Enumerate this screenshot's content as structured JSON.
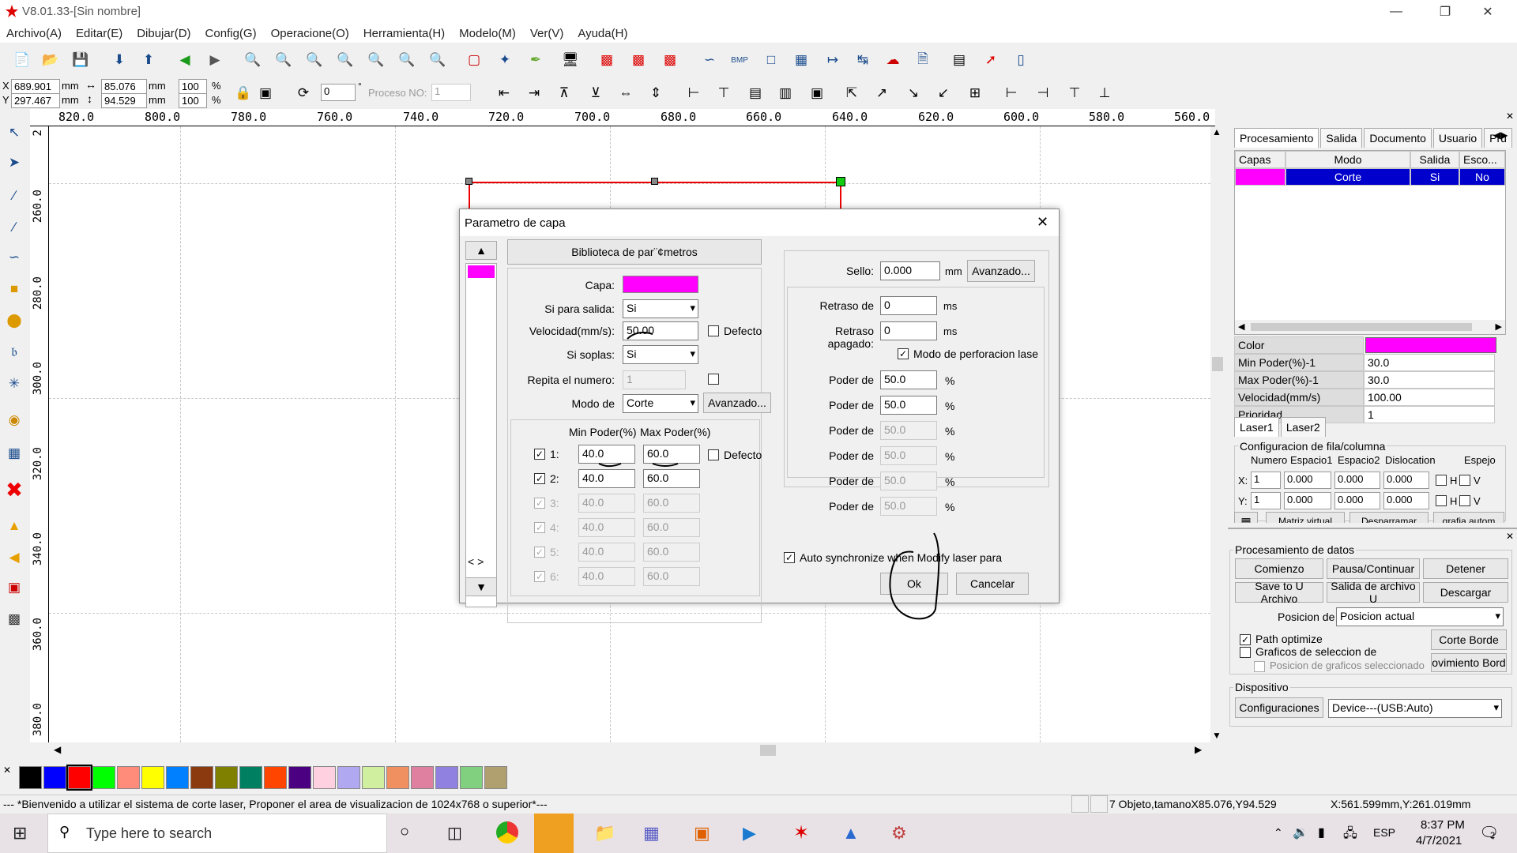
{
  "app": {
    "title": "V8.01.33-[Sin nombre]",
    "window_controls": [
      "minimize-icon",
      "restore-icon",
      "close-icon"
    ]
  },
  "menu": [
    "Archivo(A)",
    "Editar(E)",
    "Dibujar(D)",
    "Config(G)",
    "Operacione(O)",
    "Herramienta(H)",
    "Modelo(M)",
    "Ver(V)",
    "Ayuda(H)"
  ],
  "position": {
    "x": "689.901",
    "y": "297.467",
    "unit": "mm",
    "width": "85.076",
    "height": "94.529",
    "scale_w": "100",
    "scale_h": "100",
    "pct": "%",
    "rotation": "0",
    "rotation_unit": "°",
    "proceso_label": "Proceso NO:",
    "proceso_value": "1"
  },
  "ruler_h": [
    "820.0",
    "800.0",
    "780.0",
    "760.0",
    "740.0",
    "720.0",
    "700.0",
    "680.0",
    "660.0",
    "640.0",
    "620.0",
    "600.0",
    "580.0",
    "560.0"
  ],
  "ruler_v": [
    "2",
    "260.0",
    "280.0",
    "300.0",
    "320.0",
    "340.0",
    "360.0",
    "380.0"
  ],
  "palette": [
    "#000000",
    "#0000ff",
    "#ff0000",
    "#00ff00",
    "#ff8c7a",
    "#ffff00",
    "#0080ff",
    "#8b3a0f",
    "#808000",
    "#008060",
    "#ff4500",
    "#4b0082",
    "#ffd0e0",
    "#b0a8f0",
    "#d0f0a0",
    "#f09060",
    "#e080a0",
    "#9080e0",
    "#80d080",
    "#b0a070"
  ],
  "status": {
    "message": "--- *Bienvenido a utilizar el sistema de corte laser, Proponer el area de visualizacion de 1024x768 o superior*---",
    "objects": "7 Objeto,tamanoX85.076,Y94.529",
    "coords": "X:561.599mm,Y:261.019mm"
  },
  "dialog": {
    "title": "Parametro de capa",
    "library_button": "Biblioteca de par¨¢metros",
    "capa_label": "Capa:",
    "capa_color": "#ff00ff",
    "salida_label": "Si para salida:",
    "salida_value": "Si",
    "velocidad_label": "Velocidad(mm/s):",
    "velocidad_value": "50.00",
    "defecto_label": "Defecto",
    "soplas_label": "Si soplas:",
    "soplas_value": "Si",
    "repita_label": "Repita el numero:",
    "repita_value": "1",
    "modo_label": "Modo de",
    "modo_value": "Corte",
    "avanzado_label": "Avanzado...",
    "min_header": "Min Poder(%)",
    "max_header": "Max Poder(%)",
    "power_defecto": "Defecto",
    "power_rows": [
      {
        "n": "1:",
        "min": "40.0",
        "max": "60.0",
        "enabled": true
      },
      {
        "n": "2:",
        "min": "40.0",
        "max": "60.0",
        "enabled": true
      },
      {
        "n": "3:",
        "min": "40.0",
        "max": "60.0",
        "enabled": false
      },
      {
        "n": "4:",
        "min": "40.0",
        "max": "60.0",
        "enabled": false
      },
      {
        "n": "5:",
        "min": "40.0",
        "max": "60.0",
        "enabled": false
      },
      {
        "n": "6:",
        "min": "40.0",
        "max": "60.0",
        "enabled": false
      }
    ],
    "sello_label": "Sello:",
    "sello_value": "0.000",
    "sello_unit": "mm",
    "sello_avanzado": "Avanzado...",
    "retraso_label": "Retraso de",
    "retraso_value": "0",
    "retraso_apagado_label": "Retraso apagado:",
    "retraso_apagado_value": "0",
    "ms": "ms",
    "perforacion_label": "Modo de perforacion lase",
    "poder_label": "Poder de",
    "poder_rows": [
      {
        "value": "50.0",
        "enabled": true
      },
      {
        "value": "50.0",
        "enabled": true
      },
      {
        "value": "50.0",
        "enabled": false
      },
      {
        "value": "50.0",
        "enabled": false
      },
      {
        "value": "50.0",
        "enabled": false
      },
      {
        "value": "50.0",
        "enabled": false
      }
    ],
    "auto_sync_label": "Auto synchronize when Modify laser para",
    "ok_label": "Ok",
    "cancel_label": "Cancelar"
  },
  "panel": {
    "tabs": [
      "Procesamiento",
      "Salida",
      "Documento",
      "Usuario",
      "Pru"
    ],
    "layer_headers": [
      "Capas",
      "Modo",
      "Salida",
      "Esco..."
    ],
    "layer_row": {
      "color": "#ff00ff",
      "modo": "Corte",
      "salida": "Si",
      "esco": "No"
    },
    "props": [
      {
        "k": "Color",
        "v": "",
        "color": "#ff00ff"
      },
      {
        "k": "Min Poder(%)-1",
        "v": "30.0"
      },
      {
        "k": "Max Poder(%)-1",
        "v": "30.0"
      },
      {
        "k": "Velocidad(mm/s)",
        "v": "100.00"
      },
      {
        "k": "Prioridad",
        "v": "1"
      }
    ],
    "laser_tabs": [
      "Laser1",
      "Laser2"
    ],
    "array_title": "Configuracion de fila/columna",
    "array_headers": [
      "Numero",
      "Espacio1",
      "Espacio2",
      "Dislocation",
      "Espejo"
    ],
    "array_x": {
      "label": "X:",
      "num": "1",
      "e1": "0.000",
      "e2": "0.000",
      "d": "0.000"
    },
    "array_y": {
      "label": "Y:",
      "num": "1",
      "e1": "0.000",
      "e2": "0.000",
      "d": "0.000"
    },
    "h_label": "H",
    "v_label": "V",
    "partial_buttons": [
      "Matriz virtual",
      "Desparramar",
      "grafia autom"
    ],
    "data_title": "Procesamiento de datos",
    "data_buttons": [
      "Comienzo",
      "Pausa/Continuar",
      "Detener",
      "Save to U Archivo",
      "Salida de archivo U",
      "Descargar"
    ],
    "posicion_label": "Posicion de",
    "posicion_value": "Posicion actual",
    "path_optimize": "Path optimize",
    "graficos_sel": "Graficos de seleccion de",
    "posicion_graficos": "Posicion de graficos seleccionado",
    "corte_borde": "Corte Borde",
    "movimiento_borde": "ovimiento Bord",
    "dispositivo_title": "Dispositivo",
    "config_button": "Configuraciones",
    "device_value": "Device---(USB:Auto)"
  },
  "taskbar": {
    "search_placeholder": "Type here to search",
    "time": "8:37 PM",
    "date": "4/7/2021",
    "lang": "ESP",
    "notif": "2"
  }
}
